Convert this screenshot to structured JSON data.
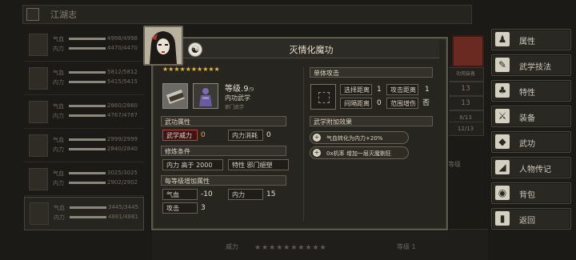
{
  "background": {
    "header_title": "江湖志",
    "party": [
      {
        "hp_label": "气血",
        "hp": "4998/4998",
        "mp_label": "内力",
        "mp": "4470/4470"
      },
      {
        "hp_label": "气血",
        "hp": "5812/5812",
        "mp_label": "内力",
        "mp": "5415/5415"
      },
      {
        "hp_label": "气血",
        "hp": "2860/2860",
        "mp_label": "内力",
        "mp": "4767/4767"
      },
      {
        "hp_label": "气血",
        "hp": "2999/2999",
        "mp_label": "内力",
        "mp": "2840/2840"
      },
      {
        "hp_label": "气血",
        "hp": "3025/3025",
        "mp_label": "内力",
        "mp": "2902/2902"
      },
      {
        "hp_label": "气血",
        "hp": "3445/3445",
        "mp_label": "内力",
        "mp": "4881/4881"
      }
    ],
    "right_values": [
      "功用装备",
      "13",
      "13",
      "8/13",
      "12/13"
    ],
    "level_label": "等级",
    "bottom_weapon": "威力",
    "bottom_stars": "★★★★★★★★★★",
    "bottom_level": "等级 1"
  },
  "menu": [
    {
      "label": "属性",
      "icon": "person-icon",
      "glyph": "♟"
    },
    {
      "label": "武学技法",
      "icon": "scroll-icon",
      "glyph": "✎"
    },
    {
      "label": "特性",
      "icon": "trait-icon",
      "glyph": "♣"
    },
    {
      "label": "装备",
      "icon": "sword-icon",
      "glyph": "⚔"
    },
    {
      "label": "武功",
      "icon": "book-icon",
      "glyph": "◆"
    },
    {
      "label": "人物传记",
      "icon": "tag-icon",
      "glyph": "◢"
    },
    {
      "label": "背包",
      "icon": "bag-icon",
      "glyph": "◉"
    },
    {
      "label": "返回",
      "icon": "door-icon",
      "glyph": "▮"
    }
  ],
  "dialog": {
    "title": "灭情化魔功",
    "stars": "★★★★★★★★★★",
    "level_label": "等级.",
    "level_value": "9",
    "level_max": "/9",
    "type": "内功武学",
    "school": "邪门武学",
    "attr_head": "武功属性",
    "attrs": [
      {
        "label": "武学威力",
        "value": "0"
      },
      {
        "label": "内力消耗",
        "value": "0"
      }
    ],
    "req_head": "修炼条件",
    "reqs": [
      {
        "label": "内力 高于 2000"
      },
      {
        "label": "特性 邪门絕塑"
      }
    ],
    "growth_head": "每等级增加属性",
    "growth": [
      {
        "label": "气血",
        "value": "-10"
      },
      {
        "label": "内力",
        "value": "15"
      },
      {
        "label": "攻击",
        "value": "3"
      }
    ],
    "attack_head": "单体攻击",
    "ranges": [
      {
        "label": "选择距离",
        "value": "1"
      },
      {
        "label": "攻击距离",
        "value": "1"
      },
      {
        "label": "间隔距离",
        "value": "0"
      },
      {
        "label": "范围增伤",
        "value": "否"
      }
    ],
    "effects_head": "武学附加效果",
    "effects": [
      "气血转化为内力+20%",
      "0x机率 增加一层灭魔剔狂"
    ]
  }
}
